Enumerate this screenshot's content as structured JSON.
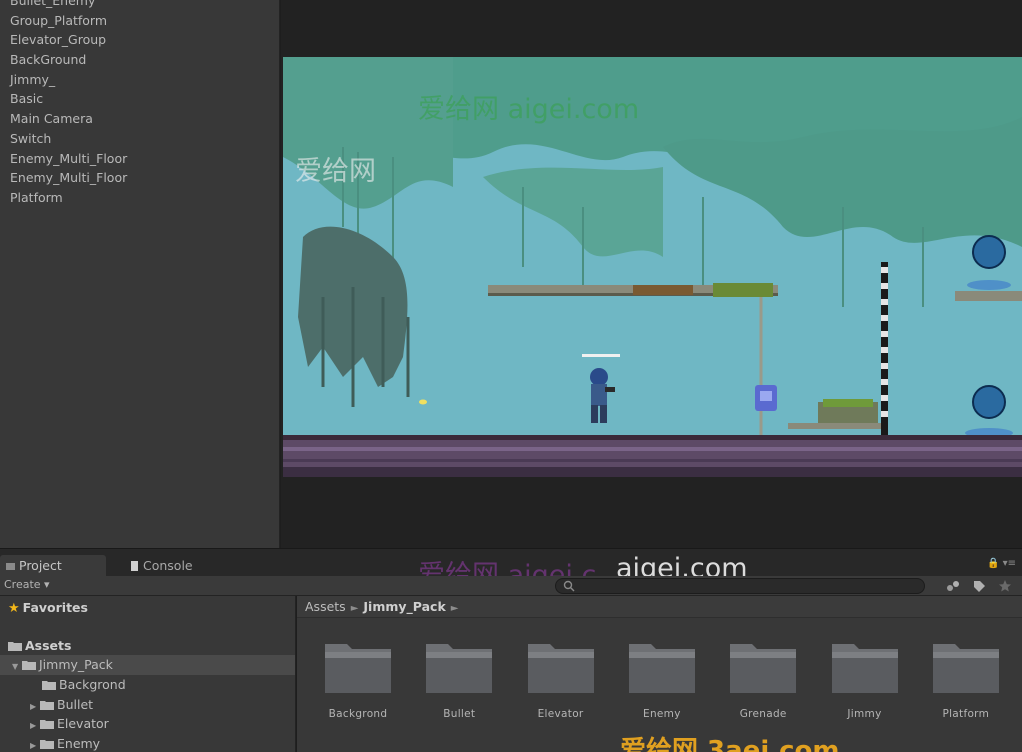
{
  "hierarchy": {
    "items": [
      "Bullet_Enemy",
      "Group_Platform",
      "Elevator_Group",
      "BackGround",
      "Jimmy_",
      "Basic",
      "Main Camera",
      "Switch",
      "Enemy_Multi_Floor",
      "Enemy_Multi_Floor",
      "Platform"
    ]
  },
  "watermarks": {
    "game_top": "爱给网 aigei.com",
    "game_left": "爱给网",
    "search_cn": "爱给网 aigei.c",
    "search_en": "aigei.com",
    "bottom": "爱给网 3aei.com"
  },
  "tabs": {
    "project": "Project",
    "console": "Console"
  },
  "toolbar": {
    "create_label": "Create ▾",
    "search_value": ""
  },
  "tree": {
    "favorites": "Favorites",
    "assets": "Assets",
    "jimmy_pack": "Jimmy_Pack",
    "children": [
      "Backgrond",
      "Bullet",
      "Elevator",
      "Enemy"
    ]
  },
  "breadcrumb": {
    "root": "Assets",
    "current": "Jimmy_Pack"
  },
  "folders": [
    "Backgrond",
    "Bullet",
    "Elevator",
    "Enemy",
    "Grenade",
    "Jimmy",
    "Platform"
  ],
  "colors": {
    "panel_bg": "#383838",
    "sky": "#6fb7c4",
    "foliage": "#4f9d8c",
    "accent_star": "#f2b71a"
  }
}
